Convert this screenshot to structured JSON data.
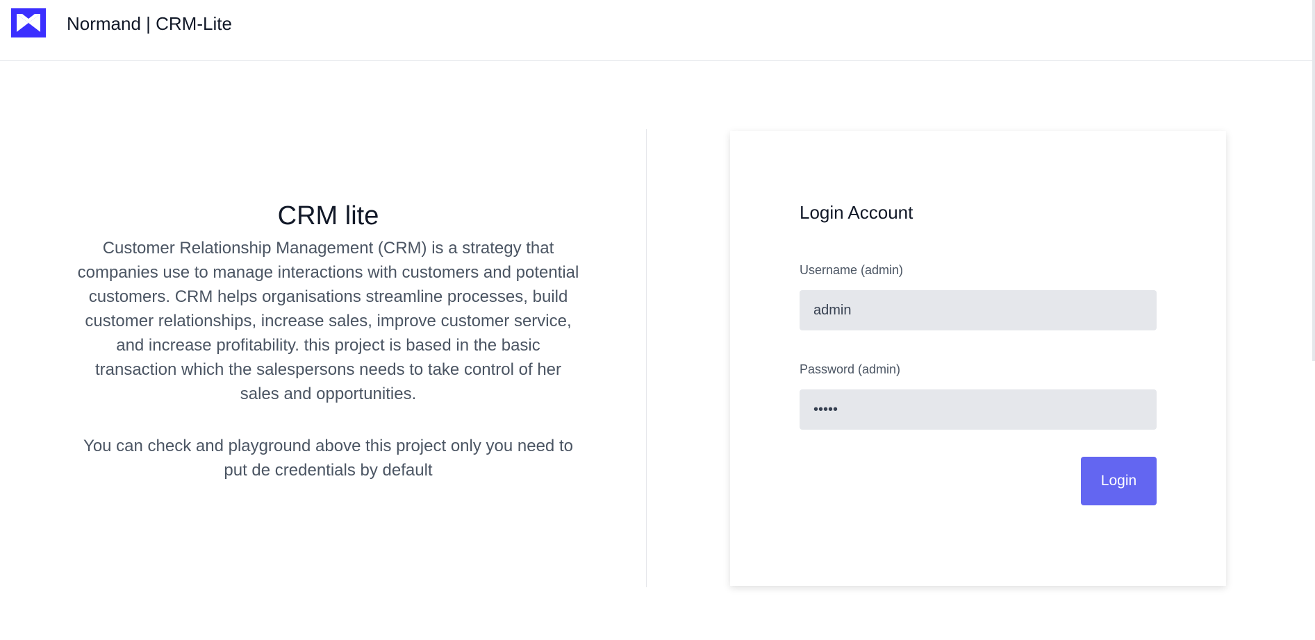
{
  "header": {
    "brand": "Normand | CRM-Lite",
    "logo_icon": "envelope-logo-icon",
    "logo_color": "#3b2fff"
  },
  "intro": {
    "title": "CRM lite",
    "paragraph_1": "Customer Relationship Management (CRM) is a strategy that companies use to manage interactions with customers and potential customers. CRM helps organisations streamline processes, build customer relationships, increase sales, improve customer service, and increase profitability. this project is based in the basic transaction which the salespersons needs to take control of her sales and opportunities.",
    "paragraph_2": "You can check and playground above this project only you need to put de credentials by default"
  },
  "login": {
    "title": "Login Account",
    "username_label": "Username (admin)",
    "username_value": "admin",
    "password_label": "Password (admin)",
    "password_value": "admin",
    "button_label": "Login",
    "accent_color": "#6366f1"
  }
}
